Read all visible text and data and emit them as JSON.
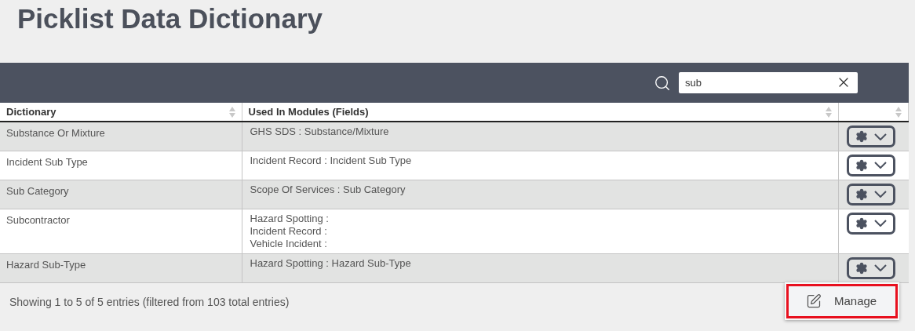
{
  "title": "Picklist Data Dictionary",
  "search": {
    "value": "sub"
  },
  "table": {
    "columns": [
      {
        "label": "Dictionary"
      },
      {
        "label": "Used In Modules (Fields)"
      },
      {}
    ],
    "rows": [
      {
        "dictionary": "Substance Or Mixture",
        "modules": [
          "GHS SDS : Substance/Mixture"
        ]
      },
      {
        "dictionary": "Incident Sub Type",
        "modules": [
          "Incident Record : Incident Sub Type"
        ]
      },
      {
        "dictionary": "Sub Category",
        "modules": [
          "Scope Of Services : Sub Category"
        ]
      },
      {
        "dictionary": "Subcontractor",
        "modules": [
          "Hazard Spotting :",
          "Incident Record :",
          "Vehicle Incident :"
        ]
      },
      {
        "dictionary": "Hazard Sub-Type",
        "modules": [
          "Hazard Spotting : Hazard Sub-Type"
        ]
      }
    ]
  },
  "footer": "Showing 1 to 5 of 5 entries (filtered from 103 total entries)",
  "menu": {
    "items": [
      {
        "label": "Manage",
        "highlighted": true
      }
    ]
  }
}
